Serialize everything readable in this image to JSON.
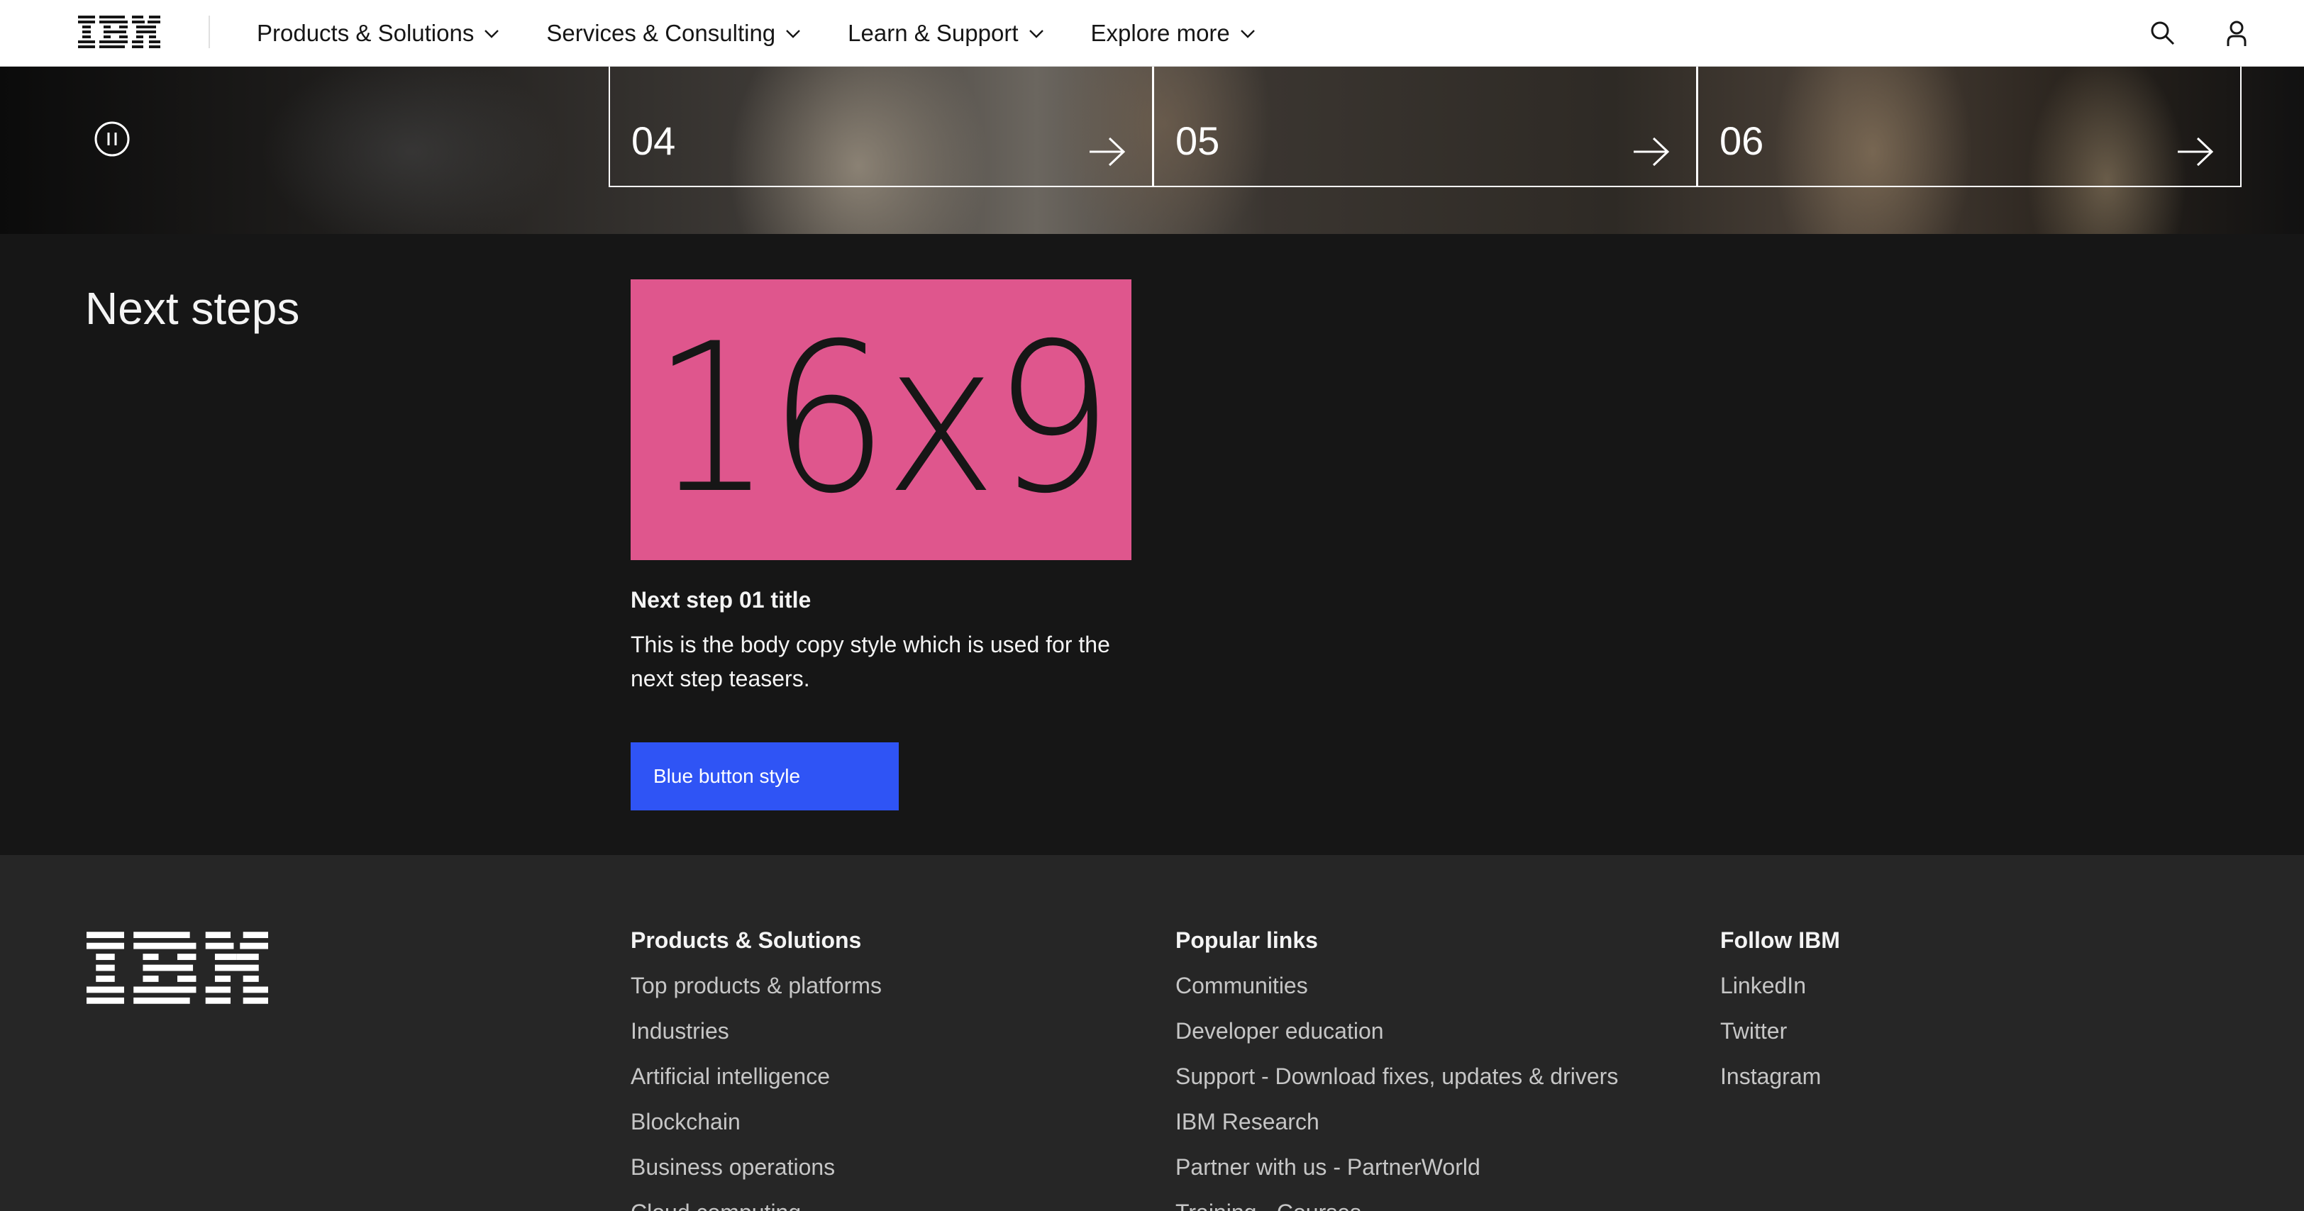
{
  "masthead": {
    "logo_text": "IBM",
    "nav": [
      {
        "label": "Products & Solutions"
      },
      {
        "label": "Services & Consulting"
      },
      {
        "label": "Learn & Support"
      },
      {
        "label": "Explore more"
      }
    ],
    "icons": [
      "search-icon",
      "user-icon"
    ]
  },
  "hero": {
    "pause_icon": "pause-icon",
    "tiles": [
      {
        "number": "04"
      },
      {
        "number": "05"
      },
      {
        "number": "06"
      }
    ]
  },
  "next_steps": {
    "heading": "Next steps",
    "card": {
      "image_text": "16x9",
      "image_color": "#df568d",
      "title": "Next step 01 title",
      "body": "This is the body copy style which is used for the next step teasers.",
      "button_label": "Blue button style",
      "button_color": "#2f54f5"
    }
  },
  "footer": {
    "logo_text": "IBM",
    "columns": [
      {
        "heading": "Products & Solutions",
        "links": [
          "Top products & platforms",
          "Industries",
          "Artificial intelligence",
          "Blockchain",
          "Business operations",
          "Cloud computing"
        ]
      },
      {
        "heading": "Popular links",
        "links": [
          "Communities",
          "Developer education",
          "Support - Download fixes, updates & drivers",
          "IBM Research",
          "Partner with us - PartnerWorld",
          "Training - Courses"
        ]
      },
      {
        "heading": "Follow IBM",
        "links": [
          "LinkedIn",
          "Twitter",
          "Instagram"
        ]
      }
    ]
  }
}
